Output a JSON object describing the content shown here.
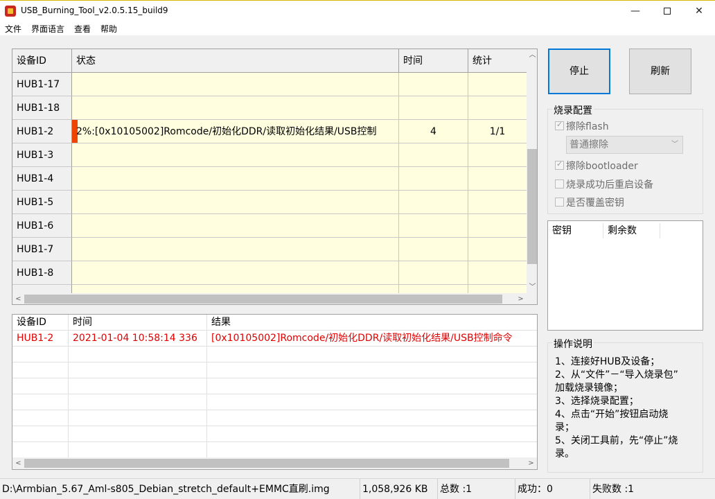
{
  "window": {
    "title": "USB_Burning_Tool_v2.0.5.15_build9",
    "controls": {
      "minimize": "—",
      "close": "✕"
    }
  },
  "menu": [
    "文件",
    "界面语言",
    "查看",
    "帮助"
  ],
  "device_grid": {
    "headers": [
      "设备ID",
      "状态",
      "时间",
      "统计"
    ],
    "rows": [
      {
        "id": "HUB1-17",
        "status": "",
        "time": "",
        "count": ""
      },
      {
        "id": "HUB1-18",
        "status": "",
        "time": "",
        "count": ""
      },
      {
        "id": "HUB1-2",
        "status": "2%:[0x10105002]Romcode/初始化DDR/读取初始化结果/USB控制",
        "time": "4",
        "count": "1/1",
        "progress_percent": 2
      },
      {
        "id": "HUB1-3",
        "status": "",
        "time": "",
        "count": ""
      },
      {
        "id": "HUB1-4",
        "status": "",
        "time": "",
        "count": ""
      },
      {
        "id": "HUB1-5",
        "status": "",
        "time": "",
        "count": ""
      },
      {
        "id": "HUB1-6",
        "status": "",
        "time": "",
        "count": ""
      },
      {
        "id": "HUB1-7",
        "status": "",
        "time": "",
        "count": ""
      },
      {
        "id": "HUB1-8",
        "status": "",
        "time": "",
        "count": ""
      },
      {
        "id": "",
        "status": "",
        "time": "",
        "count": ""
      }
    ]
  },
  "log_grid": {
    "headers": [
      "设备ID",
      "时间",
      "结果"
    ],
    "rows": [
      {
        "id": "HUB1-2",
        "time": "2021-01-04 10:58:14 336",
        "result": "[0x10105002]Romcode/初始化DDR/读取初始化结果/USB控制命令",
        "color": "#e00000"
      }
    ]
  },
  "buttons": {
    "stop": "停止",
    "refresh": "刷新"
  },
  "burn_config": {
    "title": "烧录配置",
    "erase_flash": {
      "label": "擦除flash",
      "checked": true,
      "enabled": false
    },
    "erase_mode": {
      "selected": "普通擦除"
    },
    "erase_bootloader": {
      "label": "擦除bootloader",
      "checked": true,
      "enabled": false
    },
    "reboot_after": {
      "label": "烧录成功后重启设备",
      "checked": false,
      "enabled": false
    },
    "overwrite_key": {
      "label": "是否覆盖密钥",
      "checked": false,
      "enabled": false
    }
  },
  "key_list": {
    "headers": [
      "密钥",
      "剩余数"
    ]
  },
  "instructions": {
    "title": "操作说明",
    "lines": [
      "1、连接好HUB及设备；",
      "2、从“文件”－“导入烧录包”",
      "加载烧录镜像；",
      "3、选择烧录配置；",
      "4、点击“开始”按钮启动烧",
      "录；",
      "5、关闭工具前，先“停止”烧",
      "录。"
    ]
  },
  "status_bar": {
    "image_path": "D:\\Armbian_5.67_Aml-s805_Debian_stretch_default+EMMC直刷.img",
    "size": "1,058,926 KB",
    "total": "总数 :1",
    "success": "成功：0",
    "failed": "失败数 :1"
  },
  "colors": {
    "accent": "#0078d7",
    "progress": "#ee4400",
    "error_text": "#e00000",
    "grid_cell": "#ffffe0"
  }
}
